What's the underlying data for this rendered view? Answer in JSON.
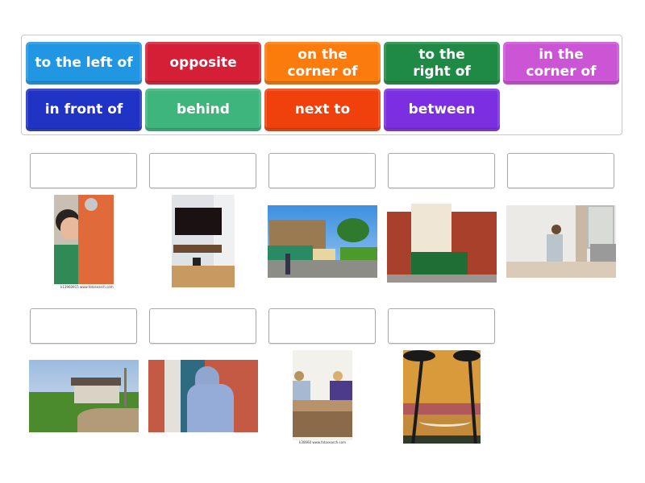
{
  "word_bank": {
    "tiles": [
      {
        "label": "to the left of",
        "color": "#2196e3"
      },
      {
        "label": "opposite",
        "color": "#d41f37"
      },
      {
        "label": "on the\ncorner of",
        "color": "#fb7b0c"
      },
      {
        "label": "to the\nright of",
        "color": "#1f8a45"
      },
      {
        "label": "in the\ncorner of",
        "color": "#cc55d6"
      },
      {
        "label": "in front of",
        "color": "#2133c4"
      },
      {
        "label": "behind",
        "color": "#3db57c"
      },
      {
        "label": "next to",
        "color": "#f0410d"
      },
      {
        "label": "between",
        "color": "#7b2fe0"
      }
    ]
  },
  "questions": [
    {
      "answer": "",
      "image": "boy peeking from behind orange door",
      "caption": "k13960915 www.fotosearch.com"
    },
    {
      "answer": "",
      "image": "TV mounted in corner of room with shelf",
      "caption": ""
    },
    {
      "answer": "",
      "image": "wooden houses along rural road",
      "caption": ""
    },
    {
      "answer": "",
      "image": "brick building on street corner with shop",
      "caption": ""
    },
    {
      "answer": "",
      "image": "boy sitting in front of TV",
      "caption": ""
    },
    {
      "answer": "",
      "image": "old house in green field by dirt road",
      "caption": ""
    },
    {
      "answer": "",
      "image": "man in hoodie next to brick wall",
      "caption": ""
    },
    {
      "answer": "",
      "image": "man and woman sitting opposite at table",
      "caption": "k30660 www.fotosearch.com"
    },
    {
      "answer": "",
      "image": "hammock between two palm trees",
      "caption": ""
    }
  ]
}
